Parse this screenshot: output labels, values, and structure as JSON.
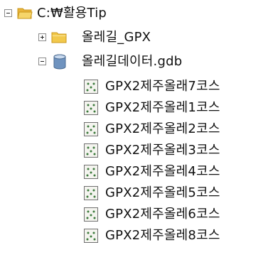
{
  "tree": {
    "root": {
      "label": "C:₩활용Tip",
      "icon": "folder-open-icon",
      "expanded": true
    },
    "children": [
      {
        "label": "올레길_GPX",
        "icon": "folder-icon",
        "expanded": false
      },
      {
        "label": "올레길데이터.gdb",
        "icon": "geodatabase-icon",
        "expanded": true
      },
      {
        "label": "GPX2제주올래7코스",
        "icon": "point-feature-class-icon"
      },
      {
        "label": "GPX2제주올레1코스",
        "icon": "point-feature-class-icon"
      },
      {
        "label": "GPX2제주올레2코스",
        "icon": "point-feature-class-icon"
      },
      {
        "label": "GPX2제주올레3코스",
        "icon": "point-feature-class-icon"
      },
      {
        "label": "GPX2제주올레4코스",
        "icon": "point-feature-class-icon"
      },
      {
        "label": "GPX2제주올레5코스",
        "icon": "point-feature-class-icon"
      },
      {
        "label": "GPX2제주올레6코스",
        "icon": "point-feature-class-icon"
      },
      {
        "label": "GPX2제주올레8코스",
        "icon": "point-feature-class-icon"
      }
    ]
  },
  "colors": {
    "folder": "#f2c94c",
    "folder_edge": "#c9961a",
    "gdb": "#5b7ea8",
    "toggle_border": "#8a8a8a"
  }
}
